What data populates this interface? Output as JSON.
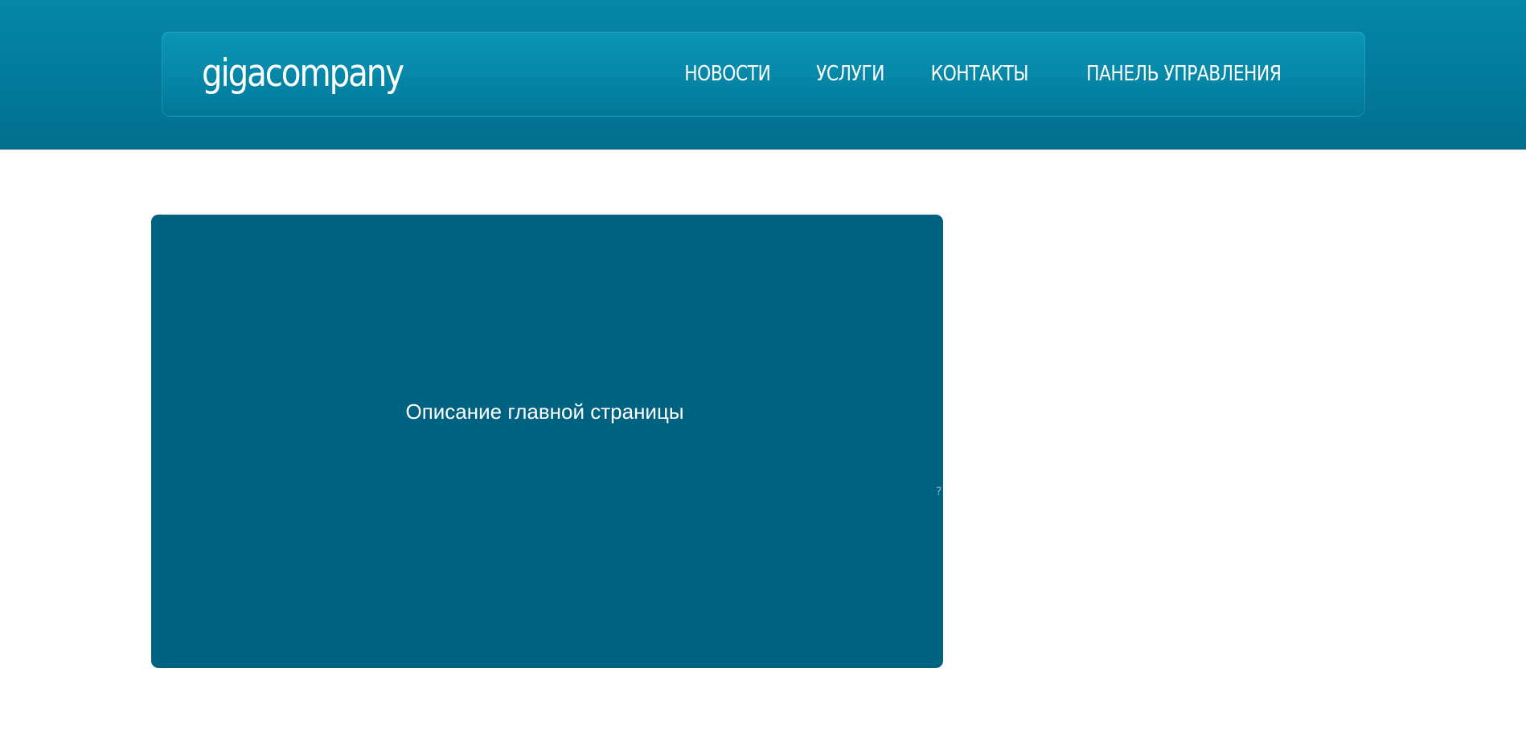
{
  "header": {
    "logo_text": "gigacompany",
    "menu": [
      {
        "label": "НОВОСТИ"
      },
      {
        "label": "УСЛУГИ"
      },
      {
        "label": "КОНТАКТЫ"
      },
      {
        "label": "ПАНЕЛЬ УПРАВЛЕНИЯ"
      }
    ]
  },
  "hero": {
    "description": "Описание главной страницы",
    "marker": "?"
  },
  "colors": {
    "header_gradient_top": "#0587a8",
    "header_gradient_bottom": "#016f8e",
    "hero_background": "#006281",
    "text": "#ffffff"
  }
}
